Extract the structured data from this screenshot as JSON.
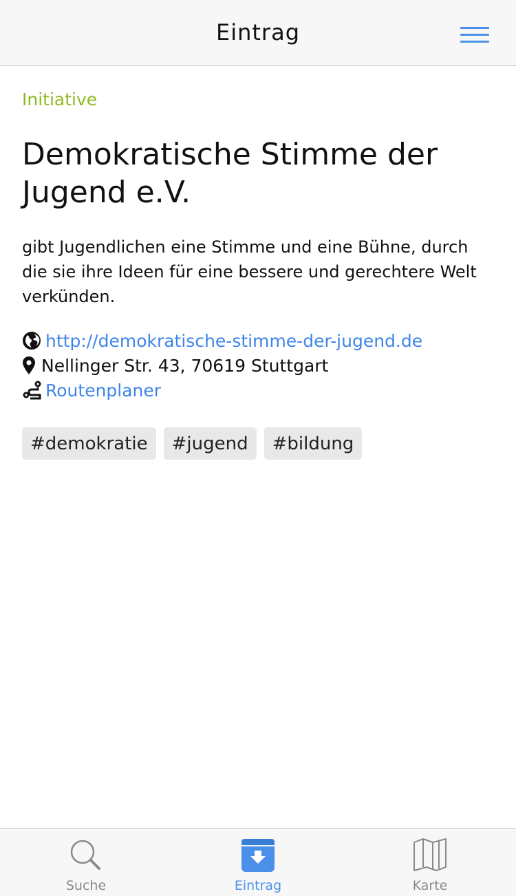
{
  "header": {
    "title": "Eintrag",
    "menu_icon": "hamburger-menu-icon",
    "accent": "#4a90e8"
  },
  "entry": {
    "category": "Initiative",
    "category_color": "#8fba1f",
    "title": "Demokratische Stimme der Jugend e.V.",
    "description": "gibt Jugendlichen eine Stimme und eine Bühne, durch die sie ihre Ideen für eine bessere und gerechtere Welt verkünden.",
    "website": "http://demokratische-stimme-der-jugend.de",
    "address": "Nellinger Str. 43, 70619 Stuttgart",
    "route_label": "Routenplaner",
    "link_color": "#3f86e8",
    "tags": [
      "#demokratie",
      "#jugend",
      "#bildung"
    ]
  },
  "tabbar": {
    "tabs": [
      {
        "label": "Suche",
        "icon": "search-icon",
        "active": false
      },
      {
        "label": "Eintrag",
        "icon": "entry-archive-icon",
        "active": true
      },
      {
        "label": "Karte",
        "icon": "map-icon",
        "active": false
      }
    ],
    "active_color": "#4a90e8",
    "inactive_color": "#8a8a8a"
  }
}
